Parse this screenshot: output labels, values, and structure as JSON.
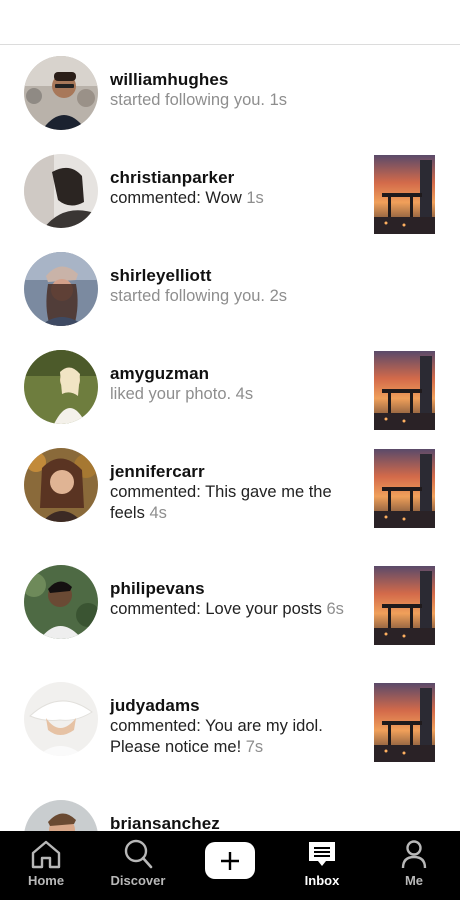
{
  "notifications": [
    {
      "username": "williamhughes",
      "message": "started following you.",
      "time": "1s",
      "style": "follow",
      "avatar": "man-glasses-city",
      "has_thumbnail": false
    },
    {
      "username": "christianparker",
      "message": "commented: Wow",
      "time": "1s",
      "style": "comment",
      "avatar": "man-profile-dark",
      "has_thumbnail": true
    },
    {
      "username": "shirleyelliott",
      "message": "started following you.",
      "time": "2s",
      "style": "follow",
      "avatar": "woman-cap",
      "has_thumbnail": false
    },
    {
      "username": "amyguzman",
      "message": "liked your photo.",
      "time": "4s",
      "style": "follow",
      "avatar": "woman-field",
      "has_thumbnail": true
    },
    {
      "username": "jennifercarr",
      "message": "commented: This gave me the feels",
      "time": "4s",
      "style": "comment",
      "avatar": "woman-curly",
      "has_thumbnail": true
    },
    {
      "username": "philipevans",
      "message": "commented: Love your posts",
      "time": "6s",
      "style": "comment",
      "avatar": "man-leaves",
      "has_thumbnail": true
    },
    {
      "username": "judyadams",
      "message": "commented: You are my idol. Please notice me!",
      "time": "7s",
      "style": "comment",
      "avatar": "woman-hat-white",
      "has_thumbnail": true
    },
    {
      "username": "briansanchez",
      "message": "",
      "time": "",
      "style": "follow",
      "avatar": "man-partial",
      "has_thumbnail": false
    }
  ],
  "tabs": [
    {
      "label": "Home",
      "icon": "home-icon",
      "active": false
    },
    {
      "label": "Discover",
      "icon": "search-icon",
      "active": false
    },
    {
      "label": "",
      "icon": "plus-icon",
      "active": false
    },
    {
      "label": "Inbox",
      "icon": "chat-bubble-icon",
      "active": true
    },
    {
      "label": "Me",
      "icon": "person-icon",
      "active": false
    }
  ],
  "colors": {
    "tabbar_bg": "#000000",
    "tab_inactive": "#b8b8b8",
    "tab_active": "#ffffff",
    "muted_text": "#8e8e8e",
    "divider": "#dcdcdc"
  }
}
